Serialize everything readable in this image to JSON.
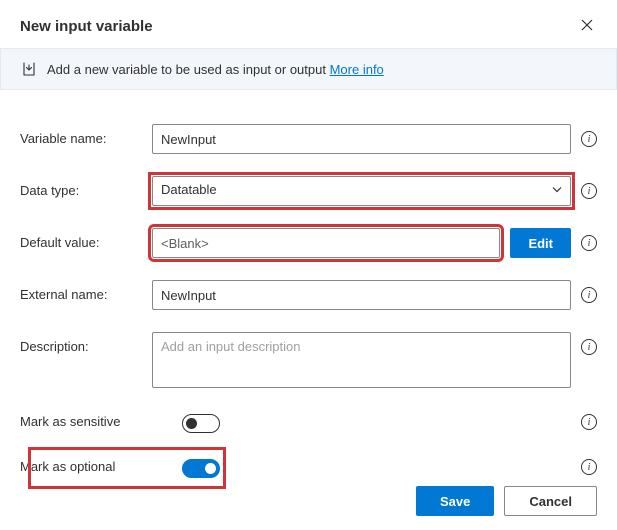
{
  "dialog": {
    "title": "New input variable",
    "banner_text": "Add a new variable to be used as input or output",
    "more_info": "More info"
  },
  "fields": {
    "variable_name": {
      "label": "Variable name:",
      "value": "NewInput"
    },
    "data_type": {
      "label": "Data type:",
      "value": "Datatable"
    },
    "default_value": {
      "label": "Default value:",
      "value": "<Blank>",
      "edit": "Edit"
    },
    "external_name": {
      "label": "External name:",
      "value": "NewInput"
    },
    "description": {
      "label": "Description:",
      "placeholder": "Add an input description"
    },
    "sensitive": {
      "label": "Mark as sensitive"
    },
    "optional": {
      "label": "Mark as optional"
    }
  },
  "footer": {
    "save": "Save",
    "cancel": "Cancel"
  }
}
